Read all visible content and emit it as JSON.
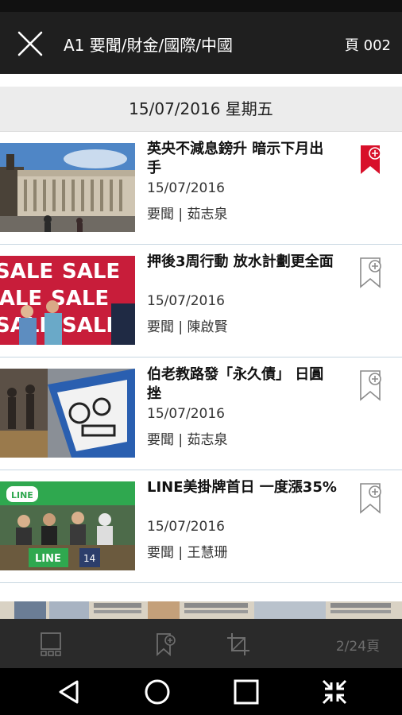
{
  "header": {
    "title": "A1 要聞/財金/國際/中國",
    "page": "頁 002"
  },
  "date_header": "15/07/2016 星期五",
  "articles": [
    {
      "title": "英央不減息鎊升 暗示下月出手",
      "date": "15/07/2016",
      "meta": "要聞 | 茹志泉",
      "bookmarked": true,
      "thumb": "bank-building"
    },
    {
      "title": "押後3周行動 放水計劃更全面",
      "date": "15/07/2016",
      "meta": "要聞 | 陳啟賢",
      "bookmarked": false,
      "thumb": "sale-posters"
    },
    {
      "title": "伯老教路發「永久債」 日圓挫",
      "date": "15/07/2016",
      "meta": "要聞 | 茹志泉",
      "bookmarked": false,
      "thumb": "currency-sign"
    },
    {
      "title": "LINE美掛牌首日 一度漲35%",
      "date": "15/07/2016",
      "meta": "要聞 | 王慧珊",
      "bookmarked": false,
      "thumb": "line-listing"
    }
  ],
  "toolbar": {
    "page_count": "2/24頁",
    "icons": [
      "grid-view-icon",
      "bookmark-add-icon",
      "crop-icon"
    ]
  },
  "colors": {
    "top_bar": "#1f1f1f",
    "toolbar": "#2a2a2a",
    "bookmark_active": "#d8102a",
    "bookmark_inactive": "#8a8a8a"
  },
  "system_nav": [
    "back-icon",
    "home-icon",
    "recents-icon",
    "collapse-icon"
  ]
}
